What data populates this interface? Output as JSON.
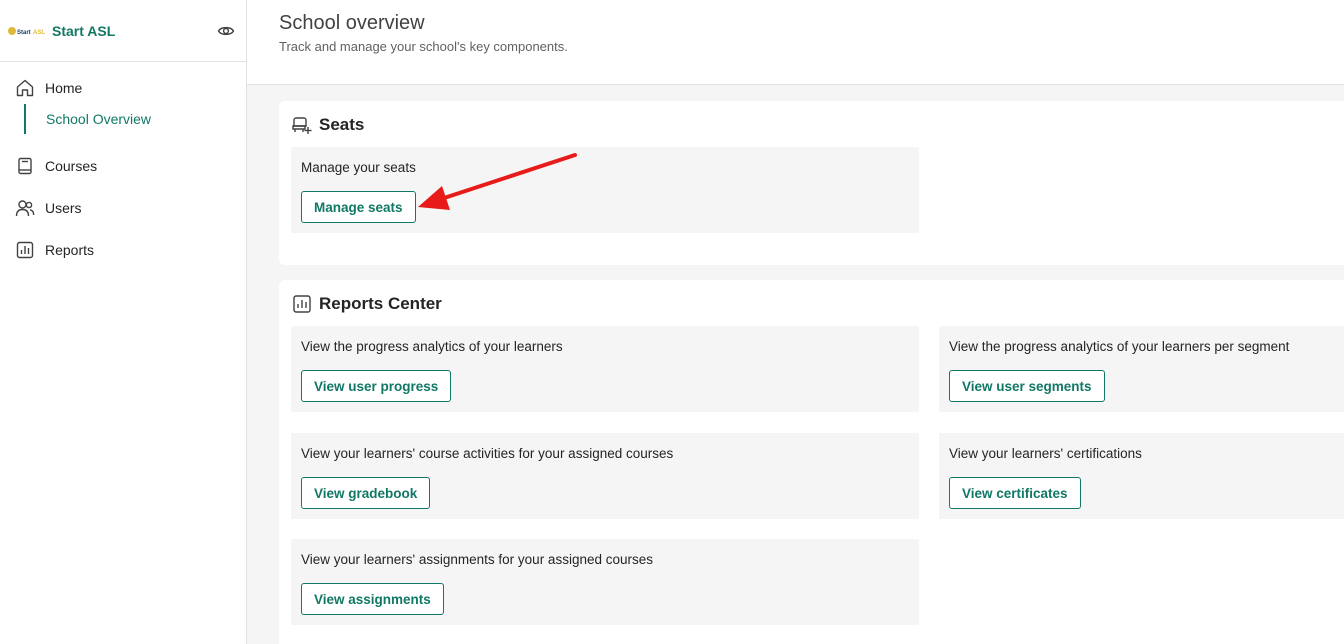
{
  "sidebar": {
    "brand": "Start ASL",
    "logo_text": "StartASL",
    "items": [
      {
        "label": "Home",
        "icon": "home-icon"
      },
      {
        "label": "School Overview"
      },
      {
        "label": "Courses",
        "icon": "book-icon"
      },
      {
        "label": "Users",
        "icon": "users-icon"
      },
      {
        "label": "Reports",
        "icon": "chart-icon"
      }
    ]
  },
  "header": {
    "title": "School overview",
    "subtitle": "Track and manage your school's key components."
  },
  "seats": {
    "title": "Seats",
    "icon": "seat-add-icon",
    "tile": {
      "text": "Manage your seats",
      "button": "Manage seats"
    }
  },
  "reports": {
    "title": "Reports Center",
    "icon": "chart-icon",
    "tiles": [
      {
        "text": "View the progress analytics of your learners",
        "button": "View user progress"
      },
      {
        "text": "View the progress analytics of your learners per segment",
        "button": "View user segments"
      },
      {
        "text": "View your learners' course activities for your assigned courses",
        "button": "View gradebook"
      },
      {
        "text": "View your learners' certifications",
        "button": "View certificates"
      },
      {
        "text": "View your learners' assignments for your assigned courses",
        "button": "View assignments"
      }
    ]
  },
  "colors": {
    "accent": "#117865",
    "annotation": "#e81a1a"
  }
}
